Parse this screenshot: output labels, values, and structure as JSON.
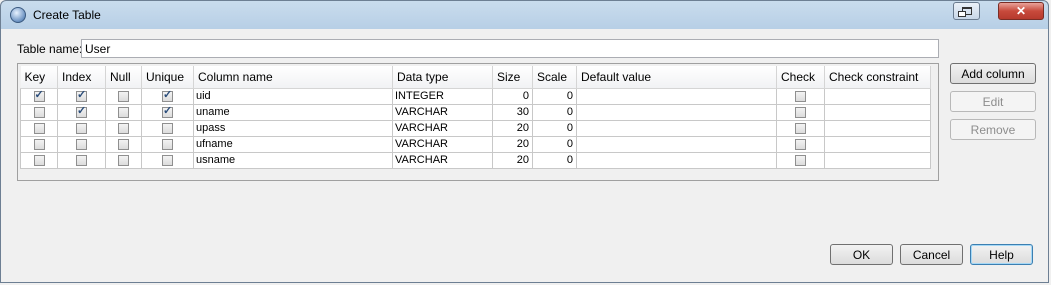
{
  "window": {
    "title": "Create Table"
  },
  "table_name": {
    "label": "Table name:",
    "value": "User"
  },
  "columns_header": [
    "Key",
    "Index",
    "Null",
    "Unique",
    "Column name",
    "Data type",
    "Size",
    "Scale",
    "Default value",
    "Check",
    "Check constraint"
  ],
  "rows": [
    {
      "key": true,
      "index": true,
      "null": false,
      "unique": true,
      "name": "uid",
      "type": "INTEGER",
      "size": "0",
      "scale": "0",
      "default": "",
      "check": false,
      "constraint": ""
    },
    {
      "key": false,
      "index": true,
      "null": false,
      "unique": true,
      "name": "uname",
      "type": "VARCHAR",
      "size": "30",
      "scale": "0",
      "default": "",
      "check": false,
      "constraint": ""
    },
    {
      "key": false,
      "index": false,
      "null": false,
      "unique": false,
      "name": "upass",
      "type": "VARCHAR",
      "size": "20",
      "scale": "0",
      "default": "",
      "check": false,
      "constraint": ""
    },
    {
      "key": false,
      "index": false,
      "null": false,
      "unique": false,
      "name": "ufname",
      "type": "VARCHAR",
      "size": "20",
      "scale": "0",
      "default": "",
      "check": false,
      "constraint": ""
    },
    {
      "key": false,
      "index": false,
      "null": false,
      "unique": false,
      "name": "usname",
      "type": "VARCHAR",
      "size": "20",
      "scale": "0",
      "default": "",
      "check": false,
      "constraint": ""
    }
  ],
  "side_buttons": {
    "add": "Add column",
    "edit": "Edit",
    "remove": "Remove"
  },
  "footer_buttons": {
    "ok": "OK",
    "cancel": "Cancel",
    "help": "Help"
  },
  "colors": {
    "title_bar": "#b7cfe6",
    "close_button": "#c84a3c",
    "dialog_bg": "#f0f0f0"
  }
}
